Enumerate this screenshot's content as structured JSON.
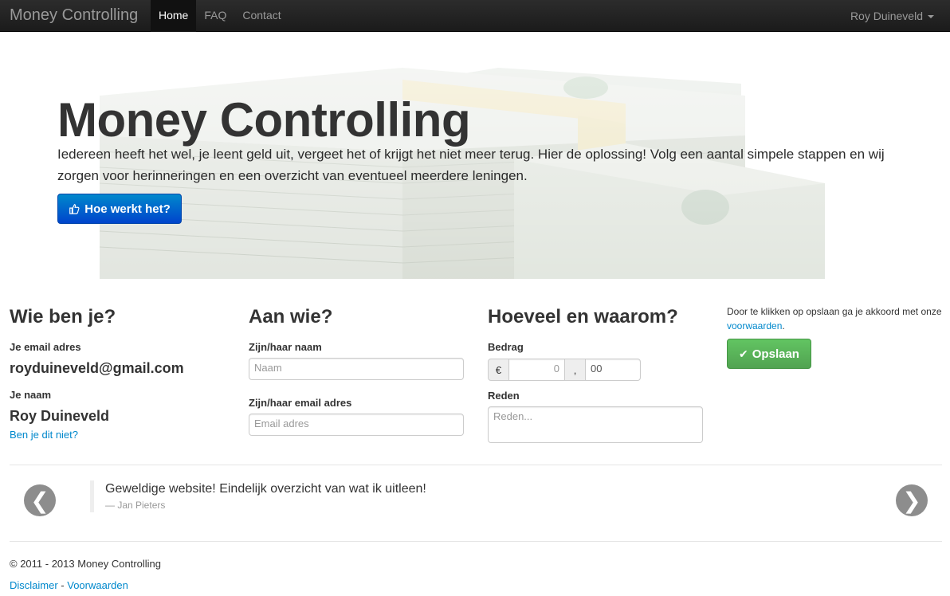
{
  "navbar": {
    "brand": "Money Controlling",
    "items": [
      {
        "label": "Home",
        "active": true
      },
      {
        "label": "FAQ",
        "active": false
      },
      {
        "label": "Contact",
        "active": false
      }
    ],
    "user": "Roy Duineveld"
  },
  "hero": {
    "title": "Money Controlling",
    "text": "Iedereen heeft het wel, je leent geld uit, vergeet het of krijgt het niet meer terug. Hier de oplossing! Volg een aantal simpele stappen en wij zorgen voor herinneringen en een overzicht van eventueel meerdere leningen.",
    "button": "Hoe werkt het?"
  },
  "who": {
    "heading": "Wie ben je?",
    "email_label": "Je email adres",
    "email": "royduineveld@gmail.com",
    "name_label": "Je naam",
    "name": "Roy Duineveld",
    "not_you": "Ben je dit niet?"
  },
  "to": {
    "heading": "Aan wie?",
    "name_label": "Zijn/haar naam",
    "name_placeholder": "Naam",
    "email_label": "Zijn/haar email adres",
    "email_placeholder": "Email adres"
  },
  "amount": {
    "heading": "Hoeveel en waarom?",
    "amount_label": "Bedrag",
    "currency": "€",
    "whole_value": "0",
    "separator": ",",
    "cents_value": "00",
    "reason_label": "Reden",
    "reason_placeholder": "Reden..."
  },
  "save": {
    "terms_prefix": "Door te klikken op opslaan ga je akkoord met onze ",
    "terms_link": "voorwaarden",
    "terms_suffix": ".",
    "button": "Opslaan"
  },
  "testimonial": {
    "quote": "Geweldige website! Eindelijk overzicht van wat ik uitleen!",
    "author": "— Jan Pieters",
    "prev": "❮",
    "next": "❯"
  },
  "footer": {
    "copyright": "© 2011 - 2013 Money Controlling",
    "disclaimer": "Disclaimer",
    "separator": " - ",
    "terms": "Voorwaarden"
  },
  "colors": {
    "primary": "#0088cc",
    "success": "#51a351",
    "navbar": "#222222"
  }
}
